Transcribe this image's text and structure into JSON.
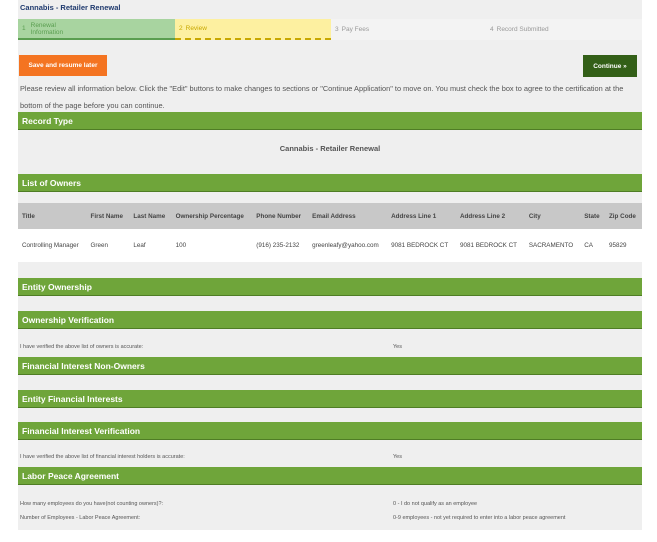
{
  "title": "Cannabis - Retailer Renewal",
  "steps": [
    {
      "num": "1",
      "label": "Renewal Information"
    },
    {
      "num": "2",
      "label": "Review"
    },
    {
      "num": "3",
      "label": "Pay Fees"
    },
    {
      "num": "4",
      "label": "Record Submitted"
    }
  ],
  "buttons": {
    "save": "Save and resume later",
    "continue": "Continue »"
  },
  "intro": "Please review all information below. Click the \"Edit\" buttons to make changes to sections or \"Continue Application\" to move on. You must check the box to agree to the certification at the bottom of the page before you can continue.",
  "sections": {
    "record_type": "Record Type",
    "record_type_value": "Cannabis - Retailer Renewal",
    "owners": "List of Owners",
    "entity_ownership": "Entity Ownership",
    "ownership_verification": "Ownership Verification",
    "fi_non_owners": "Financial Interest Non-Owners",
    "entity_fi": "Entity Financial Interests",
    "fi_verification": "Financial Interest Verification",
    "labor": "Labor Peace Agreement"
  },
  "owners_table": {
    "headers": [
      "Title",
      "First Name",
      "Last Name",
      "Ownership Percentage",
      "Phone Number",
      "Email Address",
      "Address Line 1",
      "Address Line 2",
      "City",
      "State",
      "Zip Code"
    ],
    "rows": [
      [
        "Controlling Manager",
        "Green",
        "Leaf",
        "100",
        "(916) 235-2132",
        "greenleafy@yahoo.com",
        "9081 BEDROCK CT",
        "9081 BEDROCK CT",
        "SACRAMENTO",
        "CA",
        "95829"
      ]
    ]
  },
  "ownership_verification": {
    "label": "I have verified the above list of owners is accurate:",
    "value": "Yes"
  },
  "fi_verification": {
    "label": "I have verified the above list of financial interest holders is accurate:",
    "value": "Yes"
  },
  "labor": [
    {
      "label": "How many employees do you have(not counting owners)?:",
      "value": "0 - I do not qualify as an employee"
    },
    {
      "label": "Number of Employees - Labor Peace Agreement:",
      "value": "0-9 employees - not yet required to enter into a labor peace agreement"
    }
  ]
}
